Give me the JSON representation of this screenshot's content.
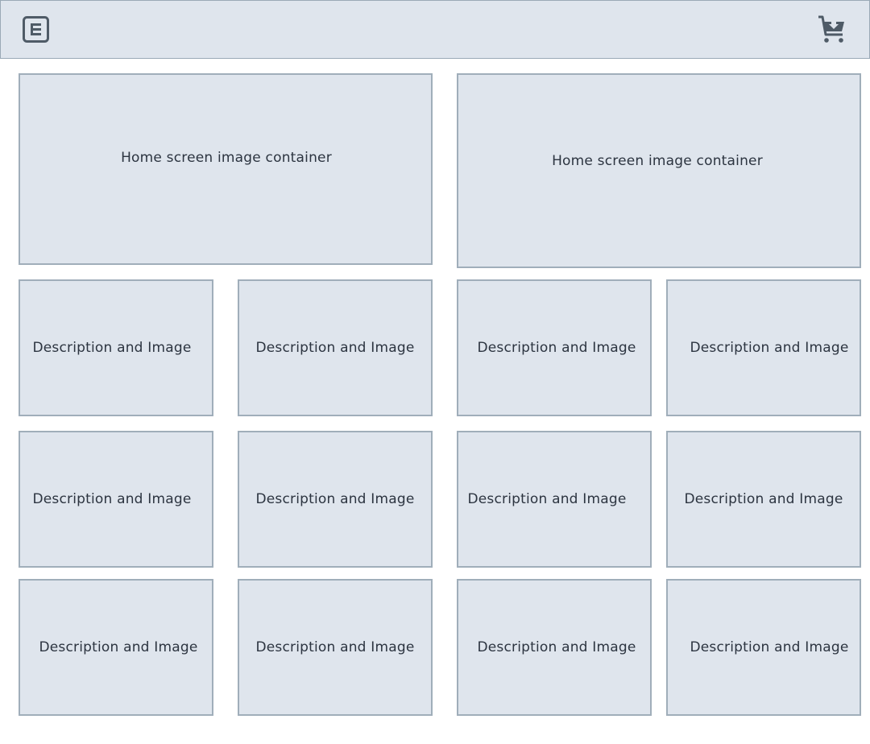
{
  "header": {
    "menu_icon": "menu-icon",
    "cart_icon": "cart-download-icon"
  },
  "hero": [
    {
      "label": "Home screen image container"
    },
    {
      "label": "Home screen image container"
    }
  ],
  "tiles": [
    {
      "label": "Description and Image"
    },
    {
      "label": "Description and Image"
    },
    {
      "label": "Description and Image"
    },
    {
      "label": "Description and Image"
    },
    {
      "label": "Description and Image"
    },
    {
      "label": "Description and Image"
    },
    {
      "label": "Description and Image"
    },
    {
      "label": "Description and Image"
    },
    {
      "label": "Description and Image"
    },
    {
      "label": "Description and Image"
    },
    {
      "label": "Description and Image"
    },
    {
      "label": "Description and Image"
    }
  ],
  "colors": {
    "background": "#dfe5ed",
    "border": "#a0aeba",
    "icon": "#4f5b67",
    "text": "#2c3440"
  }
}
